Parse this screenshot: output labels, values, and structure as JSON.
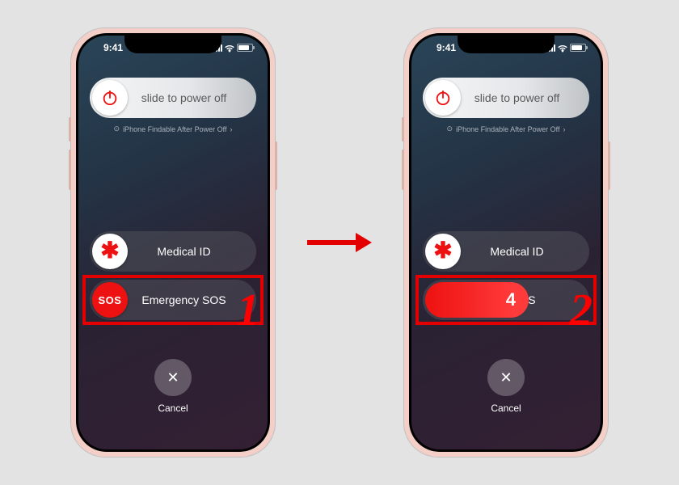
{
  "statusbar": {
    "time": "9:41"
  },
  "power_slider": {
    "label": "slide to power off"
  },
  "findable": {
    "text": "iPhone Findable After Power Off"
  },
  "medical": {
    "label": "Medical ID"
  },
  "sos": {
    "icon_text": "SOS",
    "label_full": "Emergency SOS",
    "label_during": "SOS",
    "countdown": "4"
  },
  "cancel": {
    "label": "Cancel"
  },
  "steps": {
    "one": "1",
    "two": "2"
  }
}
